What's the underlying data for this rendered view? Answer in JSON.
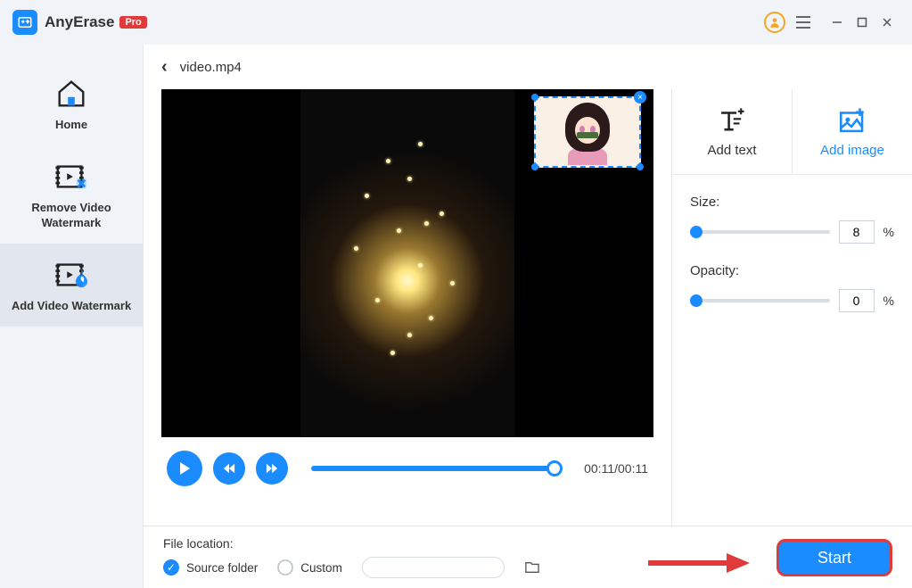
{
  "app": {
    "name": "AnyErase",
    "badge": "Pro"
  },
  "sidebar": {
    "items": [
      {
        "label": "Home"
      },
      {
        "label": "Remove Video Watermark"
      },
      {
        "label": "Add Video Watermark"
      }
    ]
  },
  "breadcrumb": {
    "file": "video.mp4"
  },
  "player": {
    "time": "00:11/00:11"
  },
  "panel": {
    "tabs": {
      "text": "Add text",
      "image": "Add image"
    },
    "size": {
      "label": "Size:",
      "value": "8",
      "unit": "%"
    },
    "opacity": {
      "label": "Opacity:",
      "value": "0",
      "unit": "%"
    }
  },
  "footer": {
    "label": "File location:",
    "source": "Source folder",
    "custom": "Custom",
    "start": "Start"
  }
}
